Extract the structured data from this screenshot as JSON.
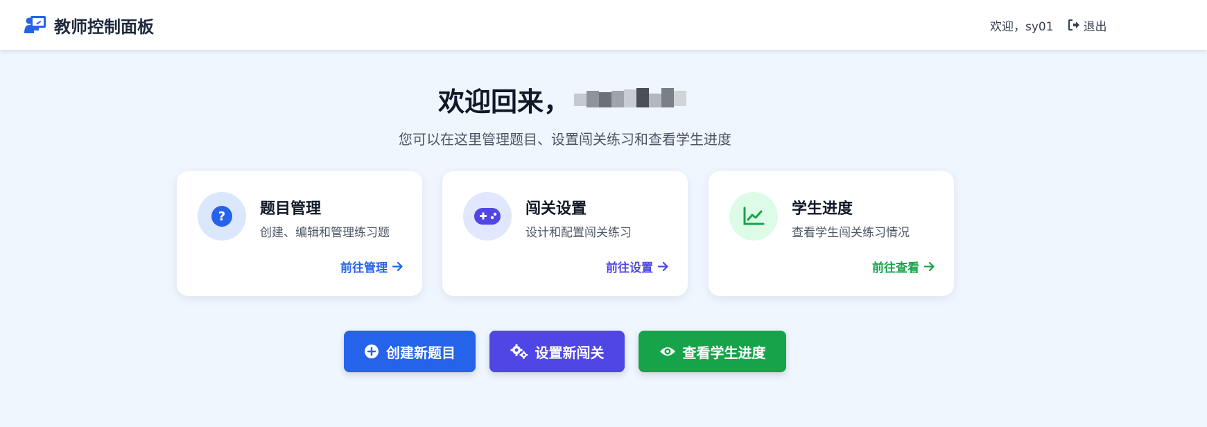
{
  "header": {
    "app_title": "教师控制面板",
    "brand_icon": "chalkboard-teacher-icon",
    "welcome_text": "欢迎，sy01",
    "logout_label": "退出",
    "logout_icon": "sign-out-icon"
  },
  "hero": {
    "title": "欢迎回来，",
    "subtitle": "您可以在这里管理题目、设置闯关练习和查看学生进度"
  },
  "cards": [
    {
      "title": "题目管理",
      "description": "创建、编辑和管理练习题",
      "link_label": "前往管理",
      "icon": "question-circle-icon",
      "accent": "#2563eb",
      "icon_bg": "#dbe7fd"
    },
    {
      "title": "闯关设置",
      "description": "设计和配置闯关练习",
      "link_label": "前往设置",
      "icon": "gamepad-icon",
      "accent": "#4f46e5",
      "icon_bg": "#e0e7ff"
    },
    {
      "title": "学生进度",
      "description": "查看学生闯关练习情况",
      "link_label": "前往查看",
      "icon": "chart-line-icon",
      "accent": "#16a34a",
      "icon_bg": "#dcfce7"
    }
  ],
  "actions": [
    {
      "label": "创建新题目",
      "icon": "plus-circle-icon",
      "color": "#2563eb"
    },
    {
      "label": "设置新闯关",
      "icon": "cogs-icon",
      "color": "#4f46e5"
    },
    {
      "label": "查看学生进度",
      "icon": "eye-icon",
      "color": "#16a34a"
    }
  ]
}
